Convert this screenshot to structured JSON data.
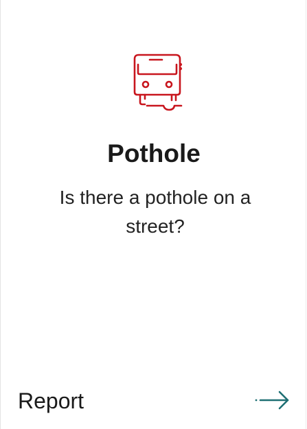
{
  "card": {
    "icon": "pothole-vehicle-icon",
    "title": "Pothole",
    "description": "Is there a pothole on a street?",
    "action_label": "Report",
    "action_icon": "arrow-right-icon"
  },
  "colors": {
    "icon": "#c8151d",
    "arrow": "#1e6f73",
    "text": "#1a1a1a"
  }
}
